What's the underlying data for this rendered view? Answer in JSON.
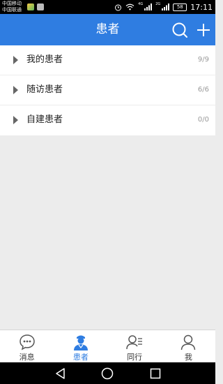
{
  "status_bar": {
    "carrier_line1": "中国移动",
    "carrier_line2": "中国联通",
    "net_4g": "4G",
    "net_2g": "2G",
    "battery": "58",
    "time": "17:11"
  },
  "header": {
    "title": "患者",
    "search_icon": "search-icon",
    "add_icon": "plus-icon",
    "background_color": "#2f7de1"
  },
  "groups": [
    {
      "label": "我的患者",
      "count": "9/9"
    },
    {
      "label": "随访患者",
      "count": "6/6"
    },
    {
      "label": "自建患者",
      "count": "0/0"
    }
  ],
  "tabs": [
    {
      "label": "消息",
      "icon": "chat-bubble-icon",
      "active": false
    },
    {
      "label": "患者",
      "icon": "doctor-icon",
      "active": true
    },
    {
      "label": "同行",
      "icon": "colleague-icon",
      "active": false
    },
    {
      "label": "我",
      "icon": "person-icon",
      "active": false
    }
  ],
  "colors": {
    "accent": "#2f7de1",
    "inactive_icon": "#555555"
  }
}
